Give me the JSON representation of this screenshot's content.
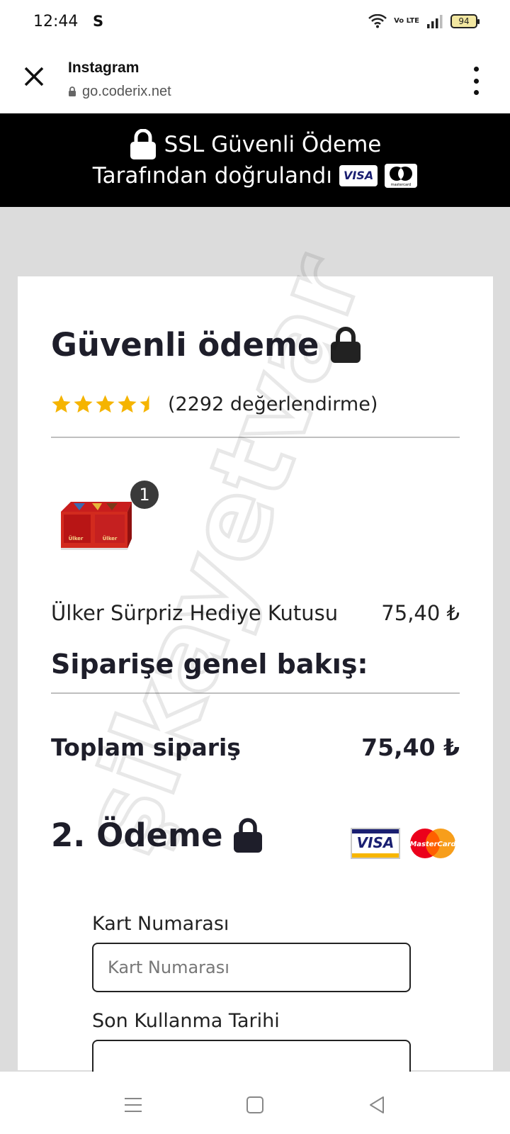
{
  "status": {
    "time": "12:44",
    "carrier_icon": "S",
    "battery": "94",
    "volte": "Vo LTE"
  },
  "browser": {
    "title": "Instagram",
    "url": "go.coderix.net"
  },
  "ssl_banner": {
    "line1": "SSL Güvenli Ödeme",
    "line2": "Tarafından doğrulandı",
    "visa_label": "VISA",
    "mc_label": "mastercard"
  },
  "checkout": {
    "heading": "Güvenli ödeme",
    "rating": 4.5,
    "rating_text": "(2292 değerlendirme)",
    "quantity": "1",
    "item_name": "Ülker Sürpriz Hediye Kutusu",
    "item_price": "75,40 ₺",
    "overview_heading": "Siparişe genel bakış:",
    "total_label": "Toplam sipariş",
    "total_value": "75,40 ₺",
    "payment_heading": "2. Ödeme",
    "visa_text": "VISA",
    "mc_text": "MasterCard",
    "card_number_label": "Kart Numarası",
    "card_number_placeholder": "Kart Numarası",
    "expiry_label": "Son Kullanma Tarihi"
  },
  "watermark": "şikayetvar",
  "colors": {
    "banner_bg": "#000000",
    "page_bg": "#dcdcdc",
    "star": "#f5b400",
    "text_dark": "#1e1e2a"
  },
  "icons": {
    "close": "close-icon",
    "menu": "more-vert-icon",
    "lock": "lock-icon",
    "nav_menu": "menu-icon",
    "nav_home": "home-square-icon",
    "nav_back": "back-triangle-icon"
  }
}
